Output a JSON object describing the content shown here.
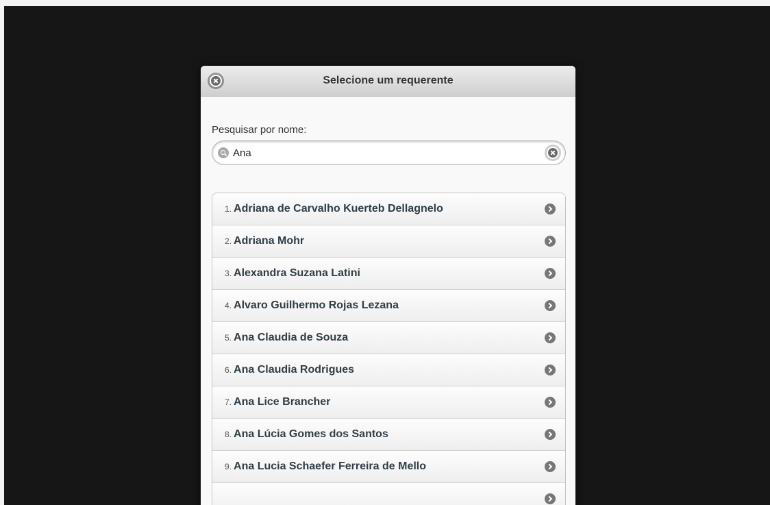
{
  "dialog": {
    "title": "Selecione um requerente"
  },
  "search": {
    "label": "Pesquisar por nome:",
    "value": "Ana"
  },
  "list": {
    "items": [
      {
        "num": "1.",
        "name": "Adriana de Carvalho Kuerteb Dellagnelo"
      },
      {
        "num": "2.",
        "name": "Adriana Mohr"
      },
      {
        "num": "3.",
        "name": "Alexandra Suzana Latini"
      },
      {
        "num": "4.",
        "name": "Alvaro Guilhermo Rojas Lezana"
      },
      {
        "num": "5.",
        "name": "Ana Claudia de Souza"
      },
      {
        "num": "6.",
        "name": "Ana Claudia Rodrigues"
      },
      {
        "num": "7.",
        "name": "Ana Lice Brancher"
      },
      {
        "num": "8.",
        "name": "Ana Lúcia Gomes dos Santos"
      },
      {
        "num": "9.",
        "name": "Ana Lucia Schaefer Ferreira de Mello"
      }
    ]
  }
}
